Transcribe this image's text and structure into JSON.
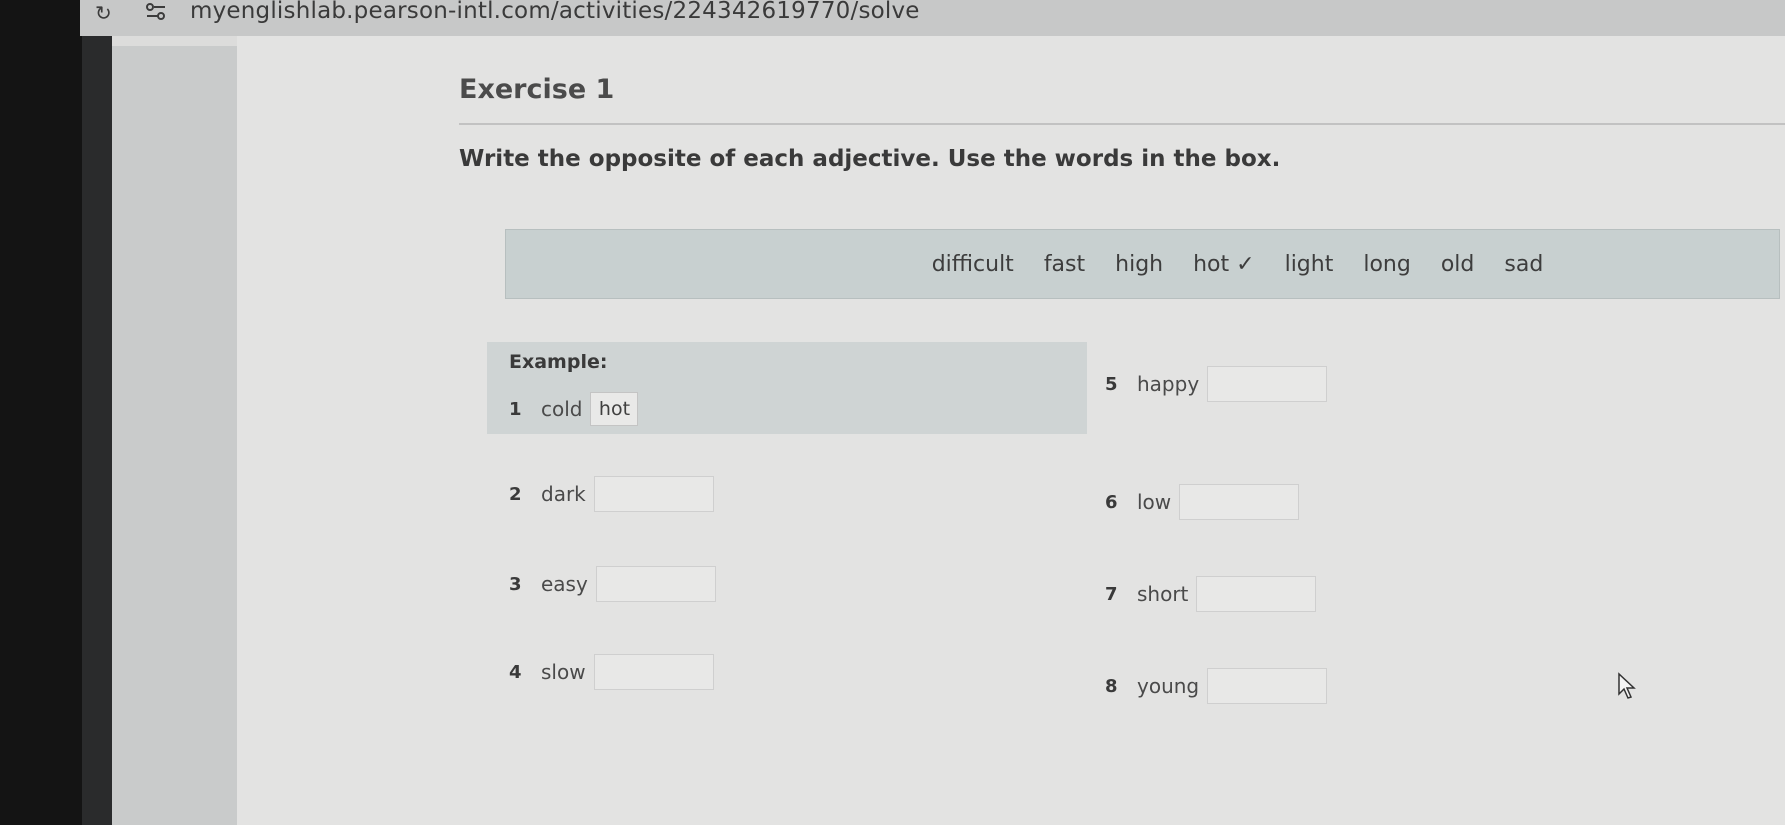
{
  "browser": {
    "url": "myenglishlab.pearson-intl.com/activities/224342619770/solve",
    "reload_icon": "reload-icon",
    "site_icon": "site-info-icon"
  },
  "exercise": {
    "title": "Exercise 1",
    "instructions": "Write the opposite of each adjective. Use the words in the box."
  },
  "word_box": {
    "words": [
      "difficult",
      "fast",
      "high",
      "hot ✓",
      "light",
      "long",
      "old",
      "sad"
    ]
  },
  "example": {
    "label": "Example:",
    "number": "1",
    "word": "cold",
    "answer": "hot"
  },
  "items": [
    {
      "number": "2",
      "word": "dark",
      "answer": ""
    },
    {
      "number": "3",
      "word": "easy",
      "answer": ""
    },
    {
      "number": "4",
      "word": "slow",
      "answer": ""
    },
    {
      "number": "5",
      "word": "happy",
      "answer": ""
    },
    {
      "number": "6",
      "word": "low",
      "answer": ""
    },
    {
      "number": "7",
      "word": "short",
      "answer": ""
    },
    {
      "number": "8",
      "word": "young",
      "answer": ""
    }
  ],
  "colors": {
    "word_box_bg": "#c8d0d0",
    "example_bg": "#cfd4d4",
    "page_bg": "#e3e3e2"
  }
}
